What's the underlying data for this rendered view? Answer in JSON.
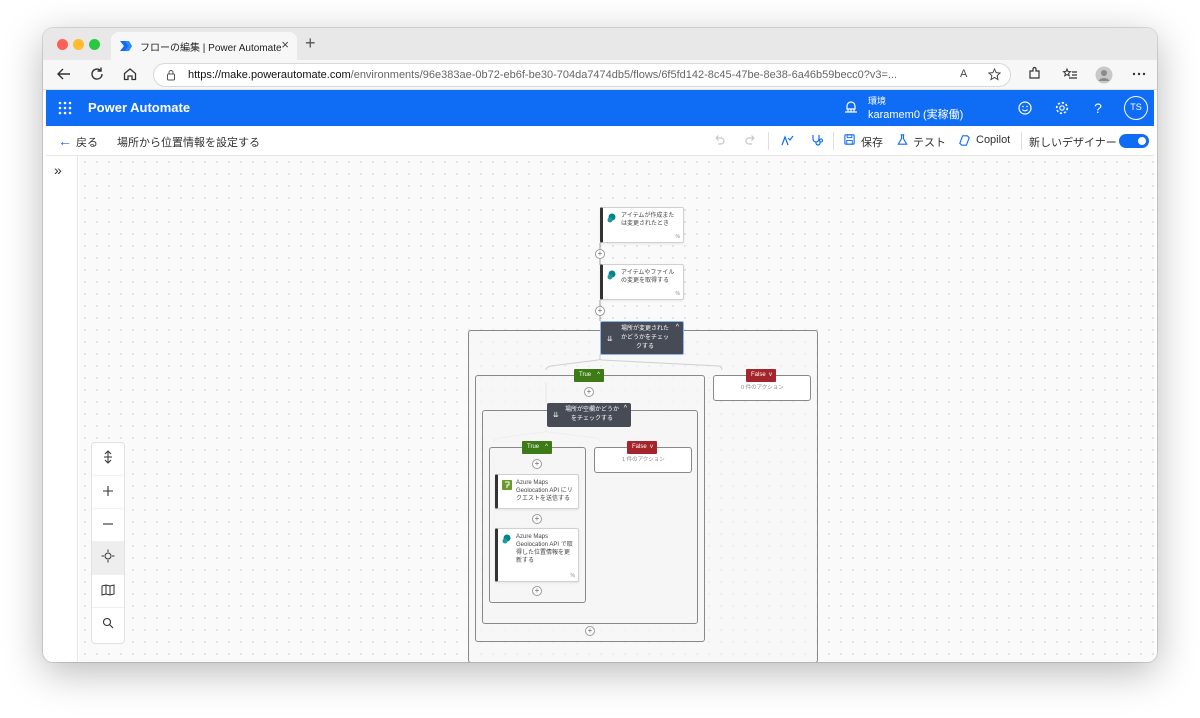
{
  "browser": {
    "tab_title": "フローの編集 | Power Automate",
    "tab_close": "×",
    "new_tab": "+",
    "url_domain": "https://make.powerautomate.com",
    "url_path": "/environments/96e383ae-0b72-eb6f-be30-704da7474db5/flows/6f5fd142-8c45-47be-8e38-6a46b59becc0?v3=...",
    "read_aloud": "A"
  },
  "app": {
    "title": "Power Automate",
    "environment_label": "環境",
    "environment_name": "karamem0 (実稼働)",
    "user_initials": "TS",
    "help": "?"
  },
  "command_bar": {
    "back_label": "戻る",
    "flow_name": "場所から位置情報を設定する",
    "save_label": "保存",
    "test_label": "テスト",
    "copilot_label": "Copilot",
    "new_designer_label": "新しいデザイナー",
    "new_designer_enabled": true
  },
  "rail": {
    "expand": "»"
  },
  "flow": {
    "trigger": {
      "text": "アイテムが作成または変更されたとき",
      "link": "%"
    },
    "get_changes": {
      "text": "アイテムやファイルの変更を取得する",
      "link": "%"
    },
    "condition_outer": {
      "text": "場所が変更されたかどうかをチェックする",
      "chevron": "^"
    },
    "outer_true": {
      "label": "True",
      "chevron": "^"
    },
    "outer_false": {
      "label": "False",
      "chevron": "v",
      "empty_text": "0 件のアクション"
    },
    "condition_inner": {
      "text": "場所が空欄かどうかをチェックする",
      "chevron": "^"
    },
    "inner_true": {
      "label": "True",
      "chevron": "^"
    },
    "inner_false": {
      "label": "False",
      "chevron": "v",
      "empty_text": "1 件のアクション"
    },
    "http_action": {
      "text": "Azure Maps Geolocation API にリクエストを送信する"
    },
    "update_action": {
      "text": "Azure Maps Geolocation API で取得した位置情報を更新する",
      "link": "%"
    },
    "add_step": "+"
  },
  "colors": {
    "brand_blue": "#0f6cf5",
    "true_green": "#3d7b16",
    "false_red": "#a4262c",
    "condition_gray": "#464b55",
    "sharepoint_teal": "#038387",
    "http_green": "#6a9a2a"
  },
  "icons": {
    "waffle": "waffle-icon",
    "environment": "environment-icon",
    "feedback": "smiley-icon",
    "settings": "gear-icon",
    "undo": "undo-icon",
    "redo": "redo-icon",
    "checker": "flow-checker-icon",
    "stethoscope": "stethoscope-icon",
    "save": "save-icon",
    "test": "flask-icon",
    "copilot": "copilot-icon"
  }
}
